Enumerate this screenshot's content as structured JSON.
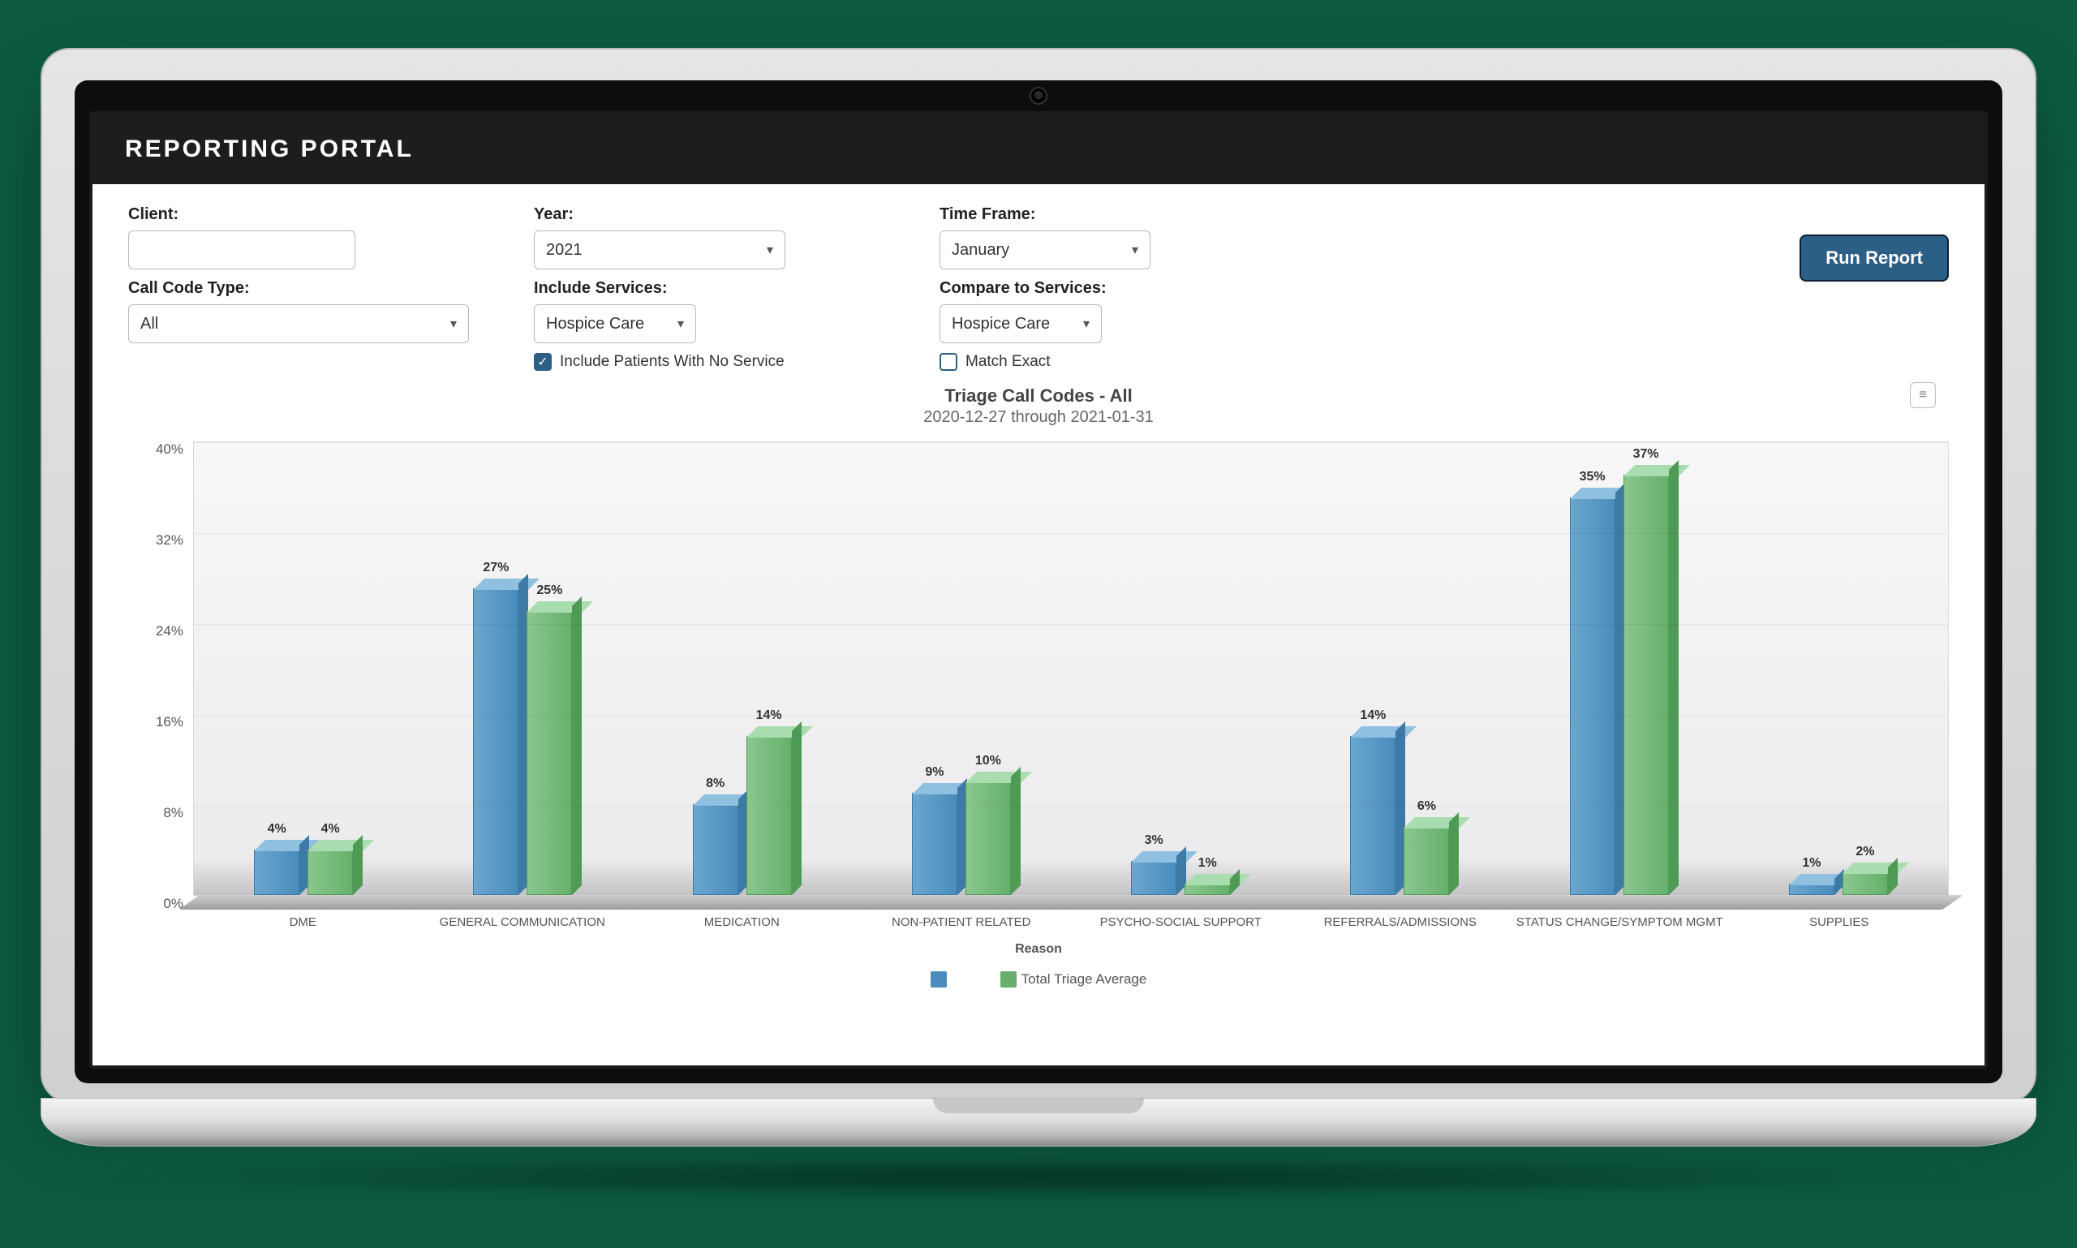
{
  "header": {
    "title": "REPORTING PORTAL"
  },
  "filters": {
    "client_label": "Client:",
    "client_value": "",
    "year_label": "Year:",
    "year_value": "2021",
    "timeframe_label": "Time Frame:",
    "timeframe_value": "January",
    "callcode_label": "Call Code Type:",
    "callcode_value": "All",
    "include_services_label": "Include Services:",
    "include_services_value": "Hospice Care",
    "compare_services_label": "Compare to Services:",
    "compare_services_value": "Hospice Care",
    "include_no_service_label": "Include Patients With No Service",
    "include_no_service_checked": true,
    "match_exact_label": "Match Exact",
    "match_exact_checked": false,
    "run_button": "Run Report"
  },
  "chart_meta": {
    "title": "Triage Call Codes - All",
    "subtitle": "2020-12-27 through 2021-01-31",
    "xlabel": "Reason",
    "legend_series_b": "Total Triage Average"
  },
  "chart_data": {
    "type": "bar",
    "title": "Triage Call Codes - All",
    "subtitle": "2020-12-27 through 2021-01-31",
    "xlabel": "Reason",
    "ylabel": "",
    "ylim": [
      0,
      40
    ],
    "yticks": [
      0,
      8,
      16,
      24,
      32,
      40
    ],
    "ytick_labels": [
      "0%",
      "8%",
      "16%",
      "24%",
      "32%",
      "40%"
    ],
    "categories": [
      "DME",
      "GENERAL COMMUNICATION",
      "MEDICATION",
      "NON-PATIENT RELATED",
      "PSYCHO-SOCIAL SUPPORT",
      "REFERRALS/ADMISSIONS",
      "STATUS CHANGE/SYMPTOM MGMT",
      "SUPPLIES"
    ],
    "series": [
      {
        "name": "",
        "color": "#4a8cbd",
        "values": [
          4,
          27,
          8,
          9,
          3,
          14,
          35,
          1
        ]
      },
      {
        "name": "Total Triage Average",
        "color": "#66b06b",
        "values": [
          4,
          25,
          14,
          10,
          1,
          6,
          37,
          2
        ]
      }
    ],
    "value_suffix": "%"
  }
}
